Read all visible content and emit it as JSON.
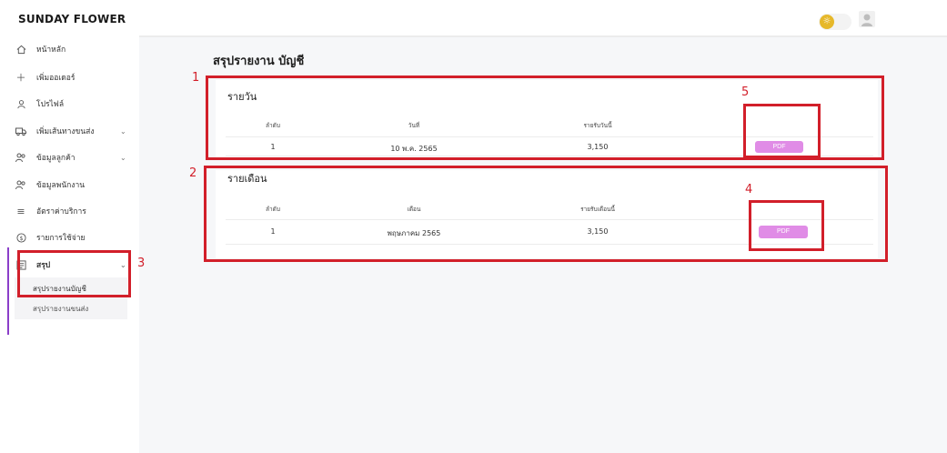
{
  "app": {
    "brand": "SUNDAY FLOWER"
  },
  "header": {
    "theme_icon": "sun-icon",
    "avatar_icon": "user-avatar-icon"
  },
  "sidebar": {
    "items": [
      {
        "label": "หน้าหลัก",
        "icon": "home-icon"
      },
      {
        "label": "เพิ่มออเดอร์",
        "icon": "plus-icon"
      },
      {
        "label": "โปรไฟล์",
        "icon": "user-icon"
      },
      {
        "label": "เพิ่มเส้นทางขนส่ง",
        "icon": "truck-icon",
        "chevron": "⌄"
      },
      {
        "label": "ข้อมูลลูกค้า",
        "icon": "users-icon",
        "chevron": "⌄"
      },
      {
        "label": "ข้อมูลพนักงาน",
        "icon": "staff-icon"
      },
      {
        "label": "อัตราค่าบริการ",
        "icon": "rate-icon"
      },
      {
        "label": "รายการใช้จ่าย",
        "icon": "money-icon"
      },
      {
        "label": "สรุป",
        "icon": "report-icon",
        "chevron": "⌄"
      }
    ],
    "submenu": [
      {
        "label": "สรุปรายงานบัญชี"
      },
      {
        "label": "สรุปรายงานขนส่ง"
      }
    ]
  },
  "main": {
    "title": "สรุปรายงาน บัญชี",
    "daily": {
      "title": "รายวัน",
      "headers": [
        "ลำดับ",
        "วันที่",
        "รายรับวันนี้"
      ],
      "rows": [
        {
          "no": "1",
          "date": "10 พ.ค. 2565",
          "amount": "3,150",
          "action": "PDF"
        }
      ]
    },
    "monthly": {
      "title": "รายเดือน",
      "headers": [
        "ลำดับ",
        "เดือน",
        "รายรับเดือนนี้"
      ],
      "rows": [
        {
          "no": "1",
          "month": "พฤษภาคม 2565",
          "amount": "3,150",
          "action": "PDF"
        }
      ]
    }
  },
  "annotations": [
    "1",
    "2",
    "3",
    "4",
    "5"
  ],
  "colors": {
    "accent": "#e08ce6",
    "annotation": "#d21f2a",
    "sidebar_active": "#8b3ec9",
    "theme_sun": "#e6b82a"
  }
}
